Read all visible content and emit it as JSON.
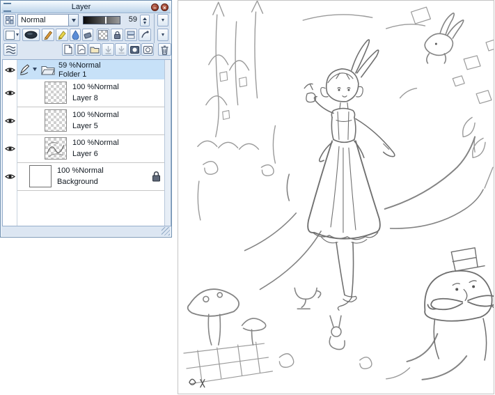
{
  "window": {
    "title": "Layer"
  },
  "icons": {
    "minimize": "–",
    "close": "×",
    "eye": "eye-shape",
    "dropdown": "triangle-down",
    "expand": "triangle-down",
    "folder": "open-folder",
    "lock": "padlock",
    "trash": "trashcan",
    "new_layer": "page",
    "new_folder": "folder",
    "droplet": "water-drop",
    "pencil": "pencil",
    "stack": "wavy-lines"
  },
  "controls": {
    "blend_mode": "Normal",
    "opacity_value": "59"
  },
  "layers": {
    "rows": [
      {
        "info": "59 %Normal",
        "name": "Folder 1"
      },
      {
        "info": "100 %Normal",
        "name": "Layer 8"
      },
      {
        "info": "100 %Normal",
        "name": "Layer 5"
      },
      {
        "info": "100 %Normal",
        "name": "Layer 6"
      },
      {
        "info": "100 %Normal",
        "name": "Background"
      }
    ]
  }
}
